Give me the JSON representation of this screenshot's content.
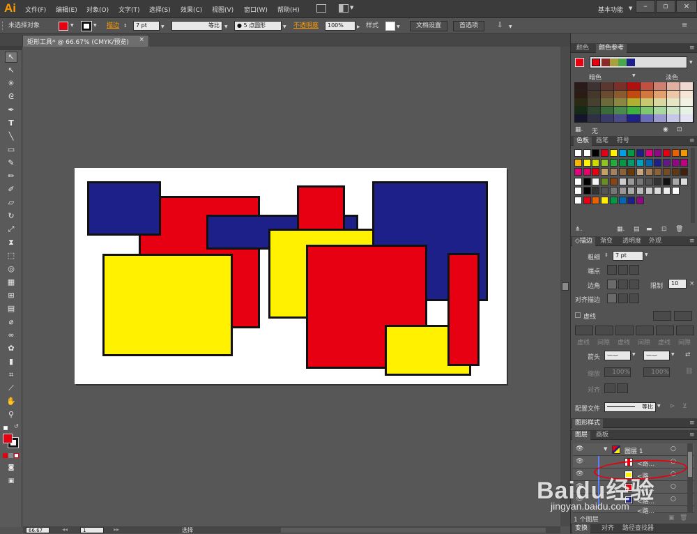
{
  "app": {
    "logo": "Ai",
    "workspace": "基本功能"
  },
  "menu": [
    "文件(F)",
    "编辑(E)",
    "对象(O)",
    "文字(T)",
    "选择(S)",
    "效果(C)",
    "视图(V)",
    "窗口(W)",
    "帮助(H)"
  ],
  "control": {
    "selection": "未选择对象",
    "stroke_label": "描边",
    "stroke_weight": "7 pt",
    "profile": "等比",
    "brush": "5 点圆形",
    "opacity_label": "不透明度",
    "opacity": "100%",
    "style_label": "样式",
    "doc_setup": "文档设置",
    "preferences": "首选项"
  },
  "document": {
    "tab_title": "矩形工具* @ 66.67% (CMYK/预览)",
    "close": "×",
    "zoom": "66.67",
    "page": "1",
    "status": "选择"
  },
  "colors": {
    "red": "#e60012",
    "blue": "#1d2088",
    "yellow": "#fff100",
    "stroke": "#111111"
  },
  "artwork": [
    {
      "fill": "red"
    },
    {
      "fill": "blue"
    },
    {
      "fill": "blue"
    },
    {
      "fill": "red"
    },
    {
      "fill": "red"
    },
    {
      "fill": "yellow"
    },
    {
      "fill": "yellow"
    },
    {
      "fill": "blue"
    },
    {
      "fill": "red"
    },
    {
      "fill": "yellow"
    },
    {
      "fill": "red"
    }
  ],
  "color_guide": {
    "tab_color": "颜色",
    "tab_guide": "颜色参考",
    "dark_label": "暗色",
    "light_label": "淡色",
    "none_label": "无"
  },
  "swatches": {
    "tab_swatches": "色板",
    "tab_brushes": "画笔",
    "tab_symbols": "符号"
  },
  "stroke_panel": {
    "tab_stroke": "描边",
    "tab_gradient": "渐变",
    "tab_transparency": "透明度",
    "tab_appearance": "外观",
    "weight_label": "粗细",
    "weight": "7 pt",
    "cap_label": "端点",
    "corner_label": "边角",
    "limit_label": "限制",
    "limit": "10",
    "align_label": "对齐描边",
    "dashed_label": "虚线",
    "dash_labels": [
      "虚线",
      "间隙",
      "虚线",
      "间隙",
      "虚线",
      "间隙"
    ],
    "arrow_label": "箭头",
    "scale_label": "缩放",
    "scale_start": "100%",
    "scale_end": "100%",
    "align2_label": "对齐",
    "profile_label": "配置文件",
    "profile": "等比"
  },
  "graphic_styles": {
    "title": "图形样式"
  },
  "layers": {
    "tab_layers": "图层",
    "tab_artboards": "画板",
    "layer_name": "图层 1",
    "items": [
      "<路...",
      "<路...",
      "<路...",
      "<路...",
      "<路..."
    ],
    "count": "1 个图层"
  },
  "bottom_tabs": [
    "变换",
    "对齐",
    "路径查找器"
  ],
  "watermark": {
    "brand": "Baidu经验",
    "url": "jingyan.baidu.com"
  }
}
